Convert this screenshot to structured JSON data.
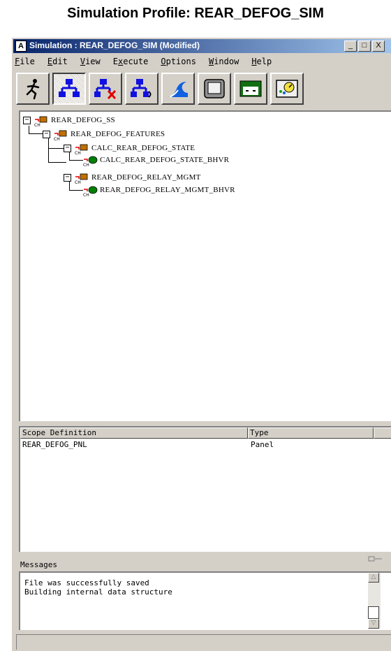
{
  "page_title": "Simulation Profile: REAR_DEFOG_SIM",
  "window": {
    "title": "Simulation : REAR_DEFOG_SIM (Modified)",
    "app_icon_glyph": "A",
    "controls": {
      "minimize": "_",
      "maximize": "□",
      "close": "X"
    }
  },
  "menubar": [
    {
      "pre": "",
      "u": "F",
      "post": "ile"
    },
    {
      "pre": "",
      "u": "E",
      "post": "dit"
    },
    {
      "pre": "",
      "u": "V",
      "post": "iew"
    },
    {
      "pre": "E",
      "u": "x",
      "post": "ecute"
    },
    {
      "pre": "",
      "u": "O",
      "post": "ptions"
    },
    {
      "pre": "",
      "u": "W",
      "post": "indow"
    },
    {
      "pre": "",
      "u": "H",
      "post": "elp"
    }
  ],
  "toolbar": [
    {
      "icon": "running-man-icon",
      "active": false
    },
    {
      "icon": "hierarchy-icon",
      "active": true
    },
    {
      "icon": "hierarchy-delete-icon",
      "active": false
    },
    {
      "icon": "hierarchy-link-icon",
      "active": false
    },
    {
      "icon": "wave-icon",
      "active": false
    },
    {
      "icon": "monitor-icon",
      "active": false
    },
    {
      "icon": "panel-icon",
      "active": false
    },
    {
      "icon": "gauge-panel-icon",
      "active": false
    }
  ],
  "tree": {
    "nodes": [
      {
        "label": "REAR_DEFOG_SS",
        "level": 0,
        "expander": "−",
        "kind": "subsystem"
      },
      {
        "label": "REAR_DEFOG_FEATURES",
        "level": 1,
        "expander": "−",
        "kind": "subsystem"
      },
      {
        "label": "CALC_REAR_DEFOG_STATE",
        "level": 2,
        "expander": "−",
        "kind": "subsystem"
      },
      {
        "label": "CALC_REAR_DEFOG_STATE_BHVR",
        "level": 3,
        "expander": "",
        "kind": "behavior"
      },
      {
        "label": "REAR_DEFOG_RELAY_MGMT",
        "level": 2,
        "expander": "−",
        "kind": "subsystem"
      },
      {
        "label": "REAR_DEFOG_RELAY_MGMT_BHVR",
        "level": 3,
        "expander": "",
        "kind": "behavior"
      }
    ],
    "icon_tag": "CH"
  },
  "scope_table": {
    "columns": [
      "Scope Definition",
      "Type"
    ],
    "rows": [
      {
        "scope": "REAR_DEFOG_PNL",
        "type": "Panel"
      }
    ]
  },
  "messages": {
    "label": "Messages",
    "lines": [
      "File was successfully saved",
      "Building internal data structure"
    ]
  },
  "colors": {
    "title_bar_start": "#08246b",
    "title_bar_end": "#a6caf0",
    "window_bg": "#d4d0c8",
    "subsystem_icon": "#c07000",
    "behavior_icon": "#008000",
    "connector_red": "#e00000"
  }
}
